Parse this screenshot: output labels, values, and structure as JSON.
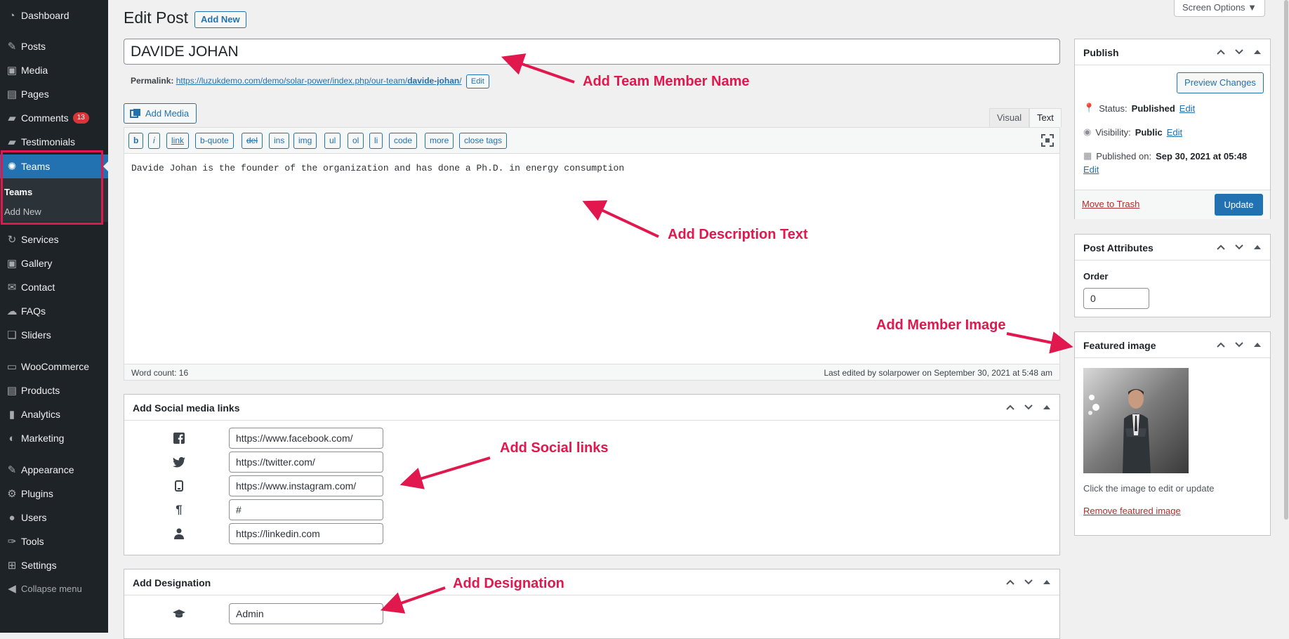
{
  "sidebar": {
    "items": [
      {
        "label": "Dashboard",
        "icon": "dashboard-icon"
      },
      {
        "label": "Posts",
        "icon": "pin-icon"
      },
      {
        "label": "Media",
        "icon": "media-icon"
      },
      {
        "label": "Pages",
        "icon": "pages-icon"
      },
      {
        "label": "Comments",
        "icon": "comment-icon",
        "badge": "13"
      },
      {
        "label": "Testimonials",
        "icon": "testimonial-icon"
      },
      {
        "label": "Teams",
        "icon": "teams-icon",
        "active": true
      },
      {
        "label": "Services",
        "icon": "services-icon"
      },
      {
        "label": "Gallery",
        "icon": "gallery-icon"
      },
      {
        "label": "Contact",
        "icon": "mail-icon"
      },
      {
        "label": "FAQs",
        "icon": "faq-icon"
      },
      {
        "label": "Sliders",
        "icon": "sliders-icon"
      },
      {
        "label": "WooCommerce",
        "icon": "woocommerce-icon"
      },
      {
        "label": "Products",
        "icon": "products-icon"
      },
      {
        "label": "Analytics",
        "icon": "analytics-icon"
      },
      {
        "label": "Marketing",
        "icon": "marketing-icon"
      },
      {
        "label": "Appearance",
        "icon": "appearance-icon"
      },
      {
        "label": "Plugins",
        "icon": "plugins-icon"
      },
      {
        "label": "Users",
        "icon": "users-icon"
      },
      {
        "label": "Tools",
        "icon": "tools-icon"
      },
      {
        "label": "Settings",
        "icon": "settings-icon"
      }
    ],
    "submenu": {
      "teams": "Teams",
      "add_new": "Add New"
    },
    "collapse": "Collapse menu"
  },
  "header": {
    "title": "Edit Post",
    "add_new": "Add New",
    "screen_options": "Screen Options ▼"
  },
  "post": {
    "title": "DAVIDE JOHAN",
    "permalink_label": "Permalink:",
    "permalink_base": "https://luzukdemo.com/demo/solar-power/index.php/our-team/",
    "permalink_slug": "davide-johan",
    "permalink_tail": "/",
    "permalink_edit": "Edit"
  },
  "editor": {
    "add_media": "Add Media",
    "tab_visual": "Visual",
    "tab_text": "Text",
    "toolbar": [
      "b",
      "i",
      "link",
      "b-quote",
      "del",
      "ins",
      "img",
      "ul",
      "ol",
      "li",
      "code",
      "more",
      "close tags"
    ],
    "content": "Davide Johan is the founder of the organization and has done a Ph.D. in energy consumption",
    "word_count": "Word count: 16",
    "last_edited": "Last edited by solarpower on September 30, 2021 at 5:48 am"
  },
  "social_box": {
    "title": "Add Social media links",
    "links": [
      {
        "icon": "facebook-icon",
        "value": "https://www.facebook.com/"
      },
      {
        "icon": "twitter-icon",
        "value": "https://twitter.com/"
      },
      {
        "icon": "mobile-icon",
        "value": "https://www.instagram.com/"
      },
      {
        "icon": "paragraph-icon",
        "value": "#"
      },
      {
        "icon": "user-icon",
        "value": "https://linkedin.com"
      }
    ]
  },
  "designation_box": {
    "title": "Add Designation",
    "icon": "graduation-cap-icon",
    "value": "Admin"
  },
  "publish_box": {
    "title": "Publish",
    "preview": "Preview Changes",
    "status_label": "Status:",
    "status_value": "Published",
    "visibility_label": "Visibility:",
    "visibility_value": "Public",
    "published_label": "Published on:",
    "published_value": "Sep 30, 2021 at 05:48",
    "edit": "Edit",
    "trash": "Move to Trash",
    "update": "Update"
  },
  "attributes_box": {
    "title": "Post Attributes",
    "order_label": "Order",
    "order_value": "0"
  },
  "featured_box": {
    "title": "Featured image",
    "hint": "Click the image to edit or update",
    "remove": "Remove featured image"
  },
  "annotations": {
    "name": "Add Team Member Name",
    "description": "Add Description Text",
    "image": "Add Member Image",
    "social": "Add Social links",
    "designation": "Add Designation"
  },
  "colors": {
    "accent": "#2271b1",
    "sidebar": "#1d2327",
    "annotation": "#e0184d",
    "badge": "#d63638"
  }
}
